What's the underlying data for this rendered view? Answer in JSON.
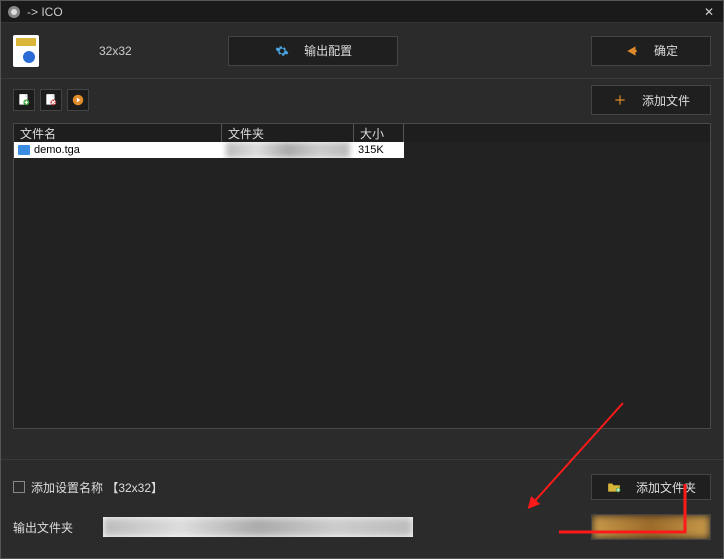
{
  "title": "-> ICO",
  "header": {
    "size_label": "32x32",
    "config_btn": "输出配置",
    "ok_btn": "确定"
  },
  "toolbar": {
    "add_file_btn": "添加文件"
  },
  "table": {
    "cols": {
      "name": "文件名",
      "folder": "文件夹",
      "size": "大小"
    },
    "rows": [
      {
        "name": "demo.tga",
        "folder": "",
        "size": "315K"
      }
    ]
  },
  "bottom": {
    "checkbox_label": "添加设置名称 【32x32】",
    "add_folder_btn": "添加文件夹",
    "output_label": "输出文件夹"
  }
}
